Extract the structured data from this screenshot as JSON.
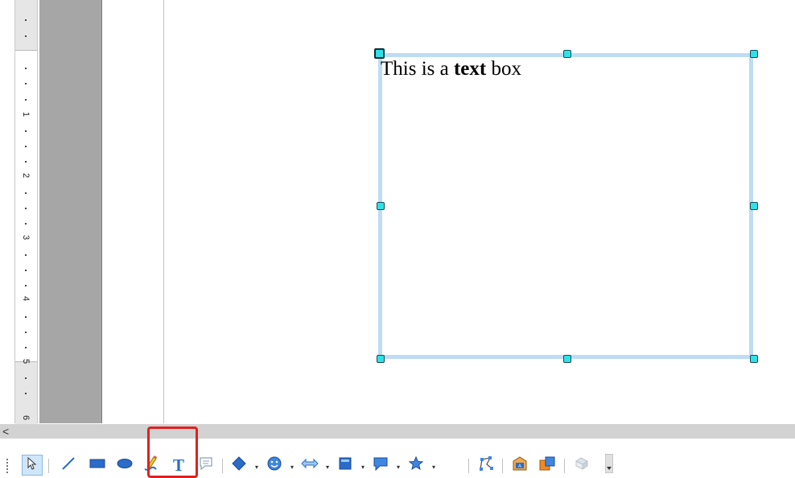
{
  "ruler": {
    "numbers": [
      "1",
      "2",
      "3",
      "4",
      "5",
      "6"
    ]
  },
  "textbox": {
    "text_before": "This is a ",
    "text_bold": "text",
    "text_after": " box"
  },
  "scrollbar": {
    "left_arrow": "<"
  },
  "toolbar": {
    "items": [
      {
        "name": "select-tool",
        "icon": "arrow-pointer-icon",
        "selected": true
      },
      {
        "name": "line-tool",
        "icon": "line-icon"
      },
      {
        "name": "rectangle-tool",
        "icon": "rectangle-icon"
      },
      {
        "name": "ellipse-tool",
        "icon": "ellipse-icon"
      },
      {
        "name": "freeform-line-tool",
        "icon": "pencil-icon"
      },
      {
        "name": "text-tool",
        "icon": "text-t-icon",
        "glyph": "T"
      },
      {
        "name": "callouts-tool",
        "icon": "speech-text-icon"
      },
      {
        "name": "basic-shapes-tool",
        "icon": "diamond-icon"
      },
      {
        "name": "symbol-shapes-tool",
        "icon": "smiley-icon"
      },
      {
        "name": "block-arrows-tool",
        "icon": "double-arrow-icon"
      },
      {
        "name": "flowchart-tool",
        "icon": "flowchart-icon"
      },
      {
        "name": "callout-shapes-tool",
        "icon": "speech-bubble-icon"
      },
      {
        "name": "stars-tool",
        "icon": "star-icon"
      },
      {
        "name": "points-tool",
        "icon": "points-icon"
      },
      {
        "name": "fontwork-tool",
        "icon": "fontwork-icon"
      },
      {
        "name": "from-file-tool",
        "icon": "image-icon"
      },
      {
        "name": "extrusion-tool",
        "icon": "extrusion-icon"
      }
    ]
  },
  "colors": {
    "accent": "#bedcf4",
    "handle": "#2ee1e8",
    "highlight": "#e02020"
  }
}
